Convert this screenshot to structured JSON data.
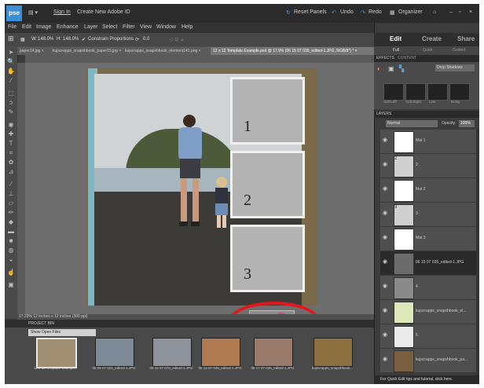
{
  "app": {
    "logo": "pse",
    "signin": "Sign In",
    "create_id": "Create New Adobe ID"
  },
  "top_actions": {
    "reset_panels": "Reset Panels",
    "undo": "Undo",
    "redo": "Redo",
    "organizer": "Organizer"
  },
  "menu": [
    "File",
    "Edit",
    "Image",
    "Enhance",
    "Layer",
    "Select",
    "Filter",
    "View",
    "Window",
    "Help"
  ],
  "options": {
    "width": "W:",
    "width_val": "148.0%",
    "height": "H:",
    "height_val": "148.0%",
    "constrain": "Constrain Proportions",
    "angle": "0.0"
  },
  "doc_tabs": [
    "paper14.jpg ×",
    "kujscrapps_snapshbook_paper15.jpg ×",
    "kujscrapps_snapshbook_element141.png ×",
    "12 x 12 Template Example.psd @ 17.9% (06 15 07 035_edited-1.JPG, RGB/8*) * ×"
  ],
  "status": "17.29%   12 inches x 12 inches (300 ppi)",
  "frames": [
    {
      "num": "1"
    },
    {
      "num": "2"
    },
    {
      "num": "3"
    }
  ],
  "bin": {
    "header": "PROJECT BIN",
    "filter": "Show Open Files",
    "items": [
      {
        "label": "12 x 12 Template Exampl..."
      },
      {
        "label": "06 09 07 021_edited-1.JPG"
      },
      {
        "label": "06 15 07 076_edited-1.JPG"
      },
      {
        "label": "06 14 07 045_edited-1.JPG"
      },
      {
        "label": "06 17 07 036_edited-1.JPG"
      },
      {
        "label": "kujscrapps_snapshbook..."
      }
    ]
  },
  "panel": {
    "tabs": [
      "Edit",
      "Create",
      "Share"
    ],
    "subtabs": [
      "Full",
      "Quick",
      "Guided"
    ],
    "effects_tabs": [
      "EFFECTS",
      "CONTENT"
    ],
    "effects_filter": "Drop Shadows",
    "fx_items": [
      "Soft Left",
      "Soft Right",
      "Low",
      "Noisy"
    ],
    "layers_header": "LAYERS",
    "blend_mode": "Normal",
    "opacity_label": "Opacity:",
    "opacity_value": "100%",
    "layers": [
      {
        "name": "Mat 1",
        "thumb": ""
      },
      {
        "name": "2",
        "thumb": "2"
      },
      {
        "name": "Mat 2",
        "thumb": ""
      },
      {
        "name": "3",
        "thumb": "3"
      },
      {
        "name": "Mat 3",
        "thumb": ""
      },
      {
        "name": "06 15 07 035_edited-1.JPG",
        "thumb": ""
      },
      {
        "name": "4",
        "thumb": ""
      },
      {
        "name": "kujscrapps_snapshbook_el...",
        "thumb": ""
      },
      {
        "name": "5",
        "thumb": ""
      },
      {
        "name": "kujscrapps_snapshbook_pa...",
        "thumb": ""
      }
    ],
    "tip": "For Quick Edit tips and tutorial, click here."
  },
  "colors": {
    "accent": "#3b8fd6",
    "commit_green": "#58b82c",
    "cancel_pink": "#d8437b",
    "annotation_red": "#e2161b"
  }
}
